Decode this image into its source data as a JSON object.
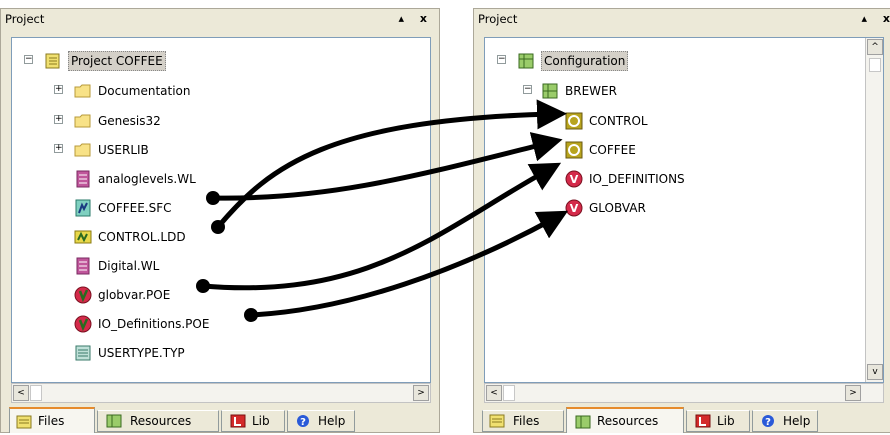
{
  "left_panel": {
    "title": "Project",
    "controls": "▴ x",
    "tree": [
      {
        "label": "Project COFFEE",
        "icon": "project-book-icon",
        "selected": true
      },
      {
        "label": "Documentation",
        "icon": "folder-icon"
      },
      {
        "label": "Genesis32",
        "icon": "folder-icon"
      },
      {
        "label": "USERLIB",
        "icon": "folder-icon"
      },
      {
        "label": "analoglevels.WL",
        "icon": "watch-list-icon"
      },
      {
        "label": "COFFEE.SFC",
        "icon": "sfc-file-icon"
      },
      {
        "label": "CONTROL.LDD",
        "icon": "ldd-file-icon"
      },
      {
        "label": "Digital.WL",
        "icon": "watch-list-icon"
      },
      {
        "label": "globvar.POE",
        "icon": "poe-file-icon"
      },
      {
        "label": "IO_Definitions.POE",
        "icon": "poe-file-icon"
      },
      {
        "label": "USERTYPE.TYP",
        "icon": "type-file-icon"
      }
    ],
    "tabs": [
      {
        "label": "Files",
        "icon": "files-icon",
        "active": true
      },
      {
        "label": "Resources",
        "icon": "resources-icon"
      },
      {
        "label": "Lib",
        "icon": "lib-icon"
      },
      {
        "label": "Help",
        "icon": "help-icon"
      }
    ]
  },
  "right_panel": {
    "title": "Project",
    "controls": "▴ x",
    "tree": [
      {
        "label": "Configuration",
        "icon": "configuration-icon",
        "selected": true
      },
      {
        "label": "BREWER",
        "icon": "resource-icon"
      },
      {
        "label": "CONTROL",
        "icon": "task-icon"
      },
      {
        "label": "COFFEE",
        "icon": "task-icon"
      },
      {
        "label": "IO_DEFINITIONS",
        "icon": "variable-group-icon"
      },
      {
        "label": "GLOBVAR",
        "icon": "variable-group-icon"
      }
    ],
    "tabs": [
      {
        "label": "Files",
        "icon": "files-icon"
      },
      {
        "label": "Resources",
        "icon": "resources-icon",
        "active": true
      },
      {
        "label": "Lib",
        "icon": "lib-icon"
      },
      {
        "label": "Help",
        "icon": "help-icon"
      }
    ]
  },
  "scroll_arrows": {
    "left": "<",
    "right": ">",
    "up": "^",
    "down": "v"
  },
  "colors": {
    "panel_bg": "#ece9d8",
    "tab_active_accent": "#e68b2c",
    "folder": "#f8e287",
    "watch_list": "#c0569b",
    "poe": "#d42a4a",
    "task": "#b8a41e",
    "arrow": "#000000"
  }
}
